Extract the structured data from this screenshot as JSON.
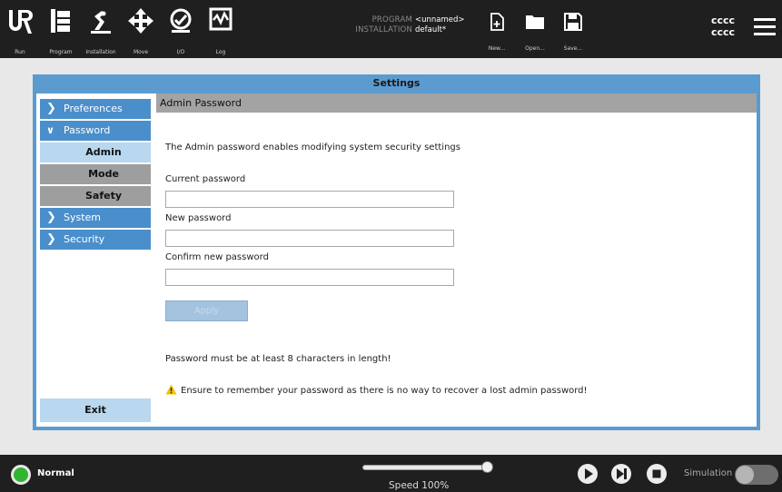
{
  "toolbar": {
    "tabs": [
      {
        "label": "Run",
        "icon": "ur-logo-icon"
      },
      {
        "label": "Program",
        "icon": "program-icon"
      },
      {
        "label": "Installation",
        "icon": "installation-icon"
      },
      {
        "label": "Move",
        "icon": "move-arrows-icon"
      },
      {
        "label": "I/O",
        "icon": "io-icon"
      },
      {
        "label": "Log",
        "icon": "log-icon"
      }
    ],
    "program_key": "PROGRAM",
    "program_value": "<unnamed>",
    "installation_key": "INSTALLATION",
    "installation_value": "default*",
    "file_buttons": [
      {
        "label": "New...",
        "icon": "new-file-icon"
      },
      {
        "label": "Open...",
        "icon": "folder-icon"
      },
      {
        "label": "Save...",
        "icon": "save-icon"
      }
    ],
    "user_line1": "cccc",
    "user_line2": "cccc"
  },
  "settings": {
    "title": "Settings",
    "nav": {
      "preferences": "Preferences",
      "password": "Password",
      "admin": "Admin",
      "mode": "Mode",
      "safety": "Safety",
      "system": "System",
      "security": "Security",
      "exit": "Exit"
    },
    "content": {
      "heading": "Admin Password",
      "description": "The Admin password enables modifying system security settings",
      "current_label": "Current password",
      "current_value": "",
      "new_label": "New password",
      "new_value": "",
      "confirm_label": "Confirm new password",
      "confirm_value": "",
      "apply_label": "Apply",
      "length_note": "Password must be at least 8 characters in length!",
      "warning": "Ensure to remember your password as there is no way to recover a lost admin password!"
    }
  },
  "footer": {
    "status": "Normal",
    "status_color": "#2fb52f",
    "speed_label": "Speed 100%",
    "speed_percent": 100,
    "simulation_label": "Simulation",
    "simulation_on": false
  },
  "colors": {
    "accent": "#5b9bd0",
    "nav_item": "#4a8fcb",
    "nav_active": "#b9d7ee"
  }
}
